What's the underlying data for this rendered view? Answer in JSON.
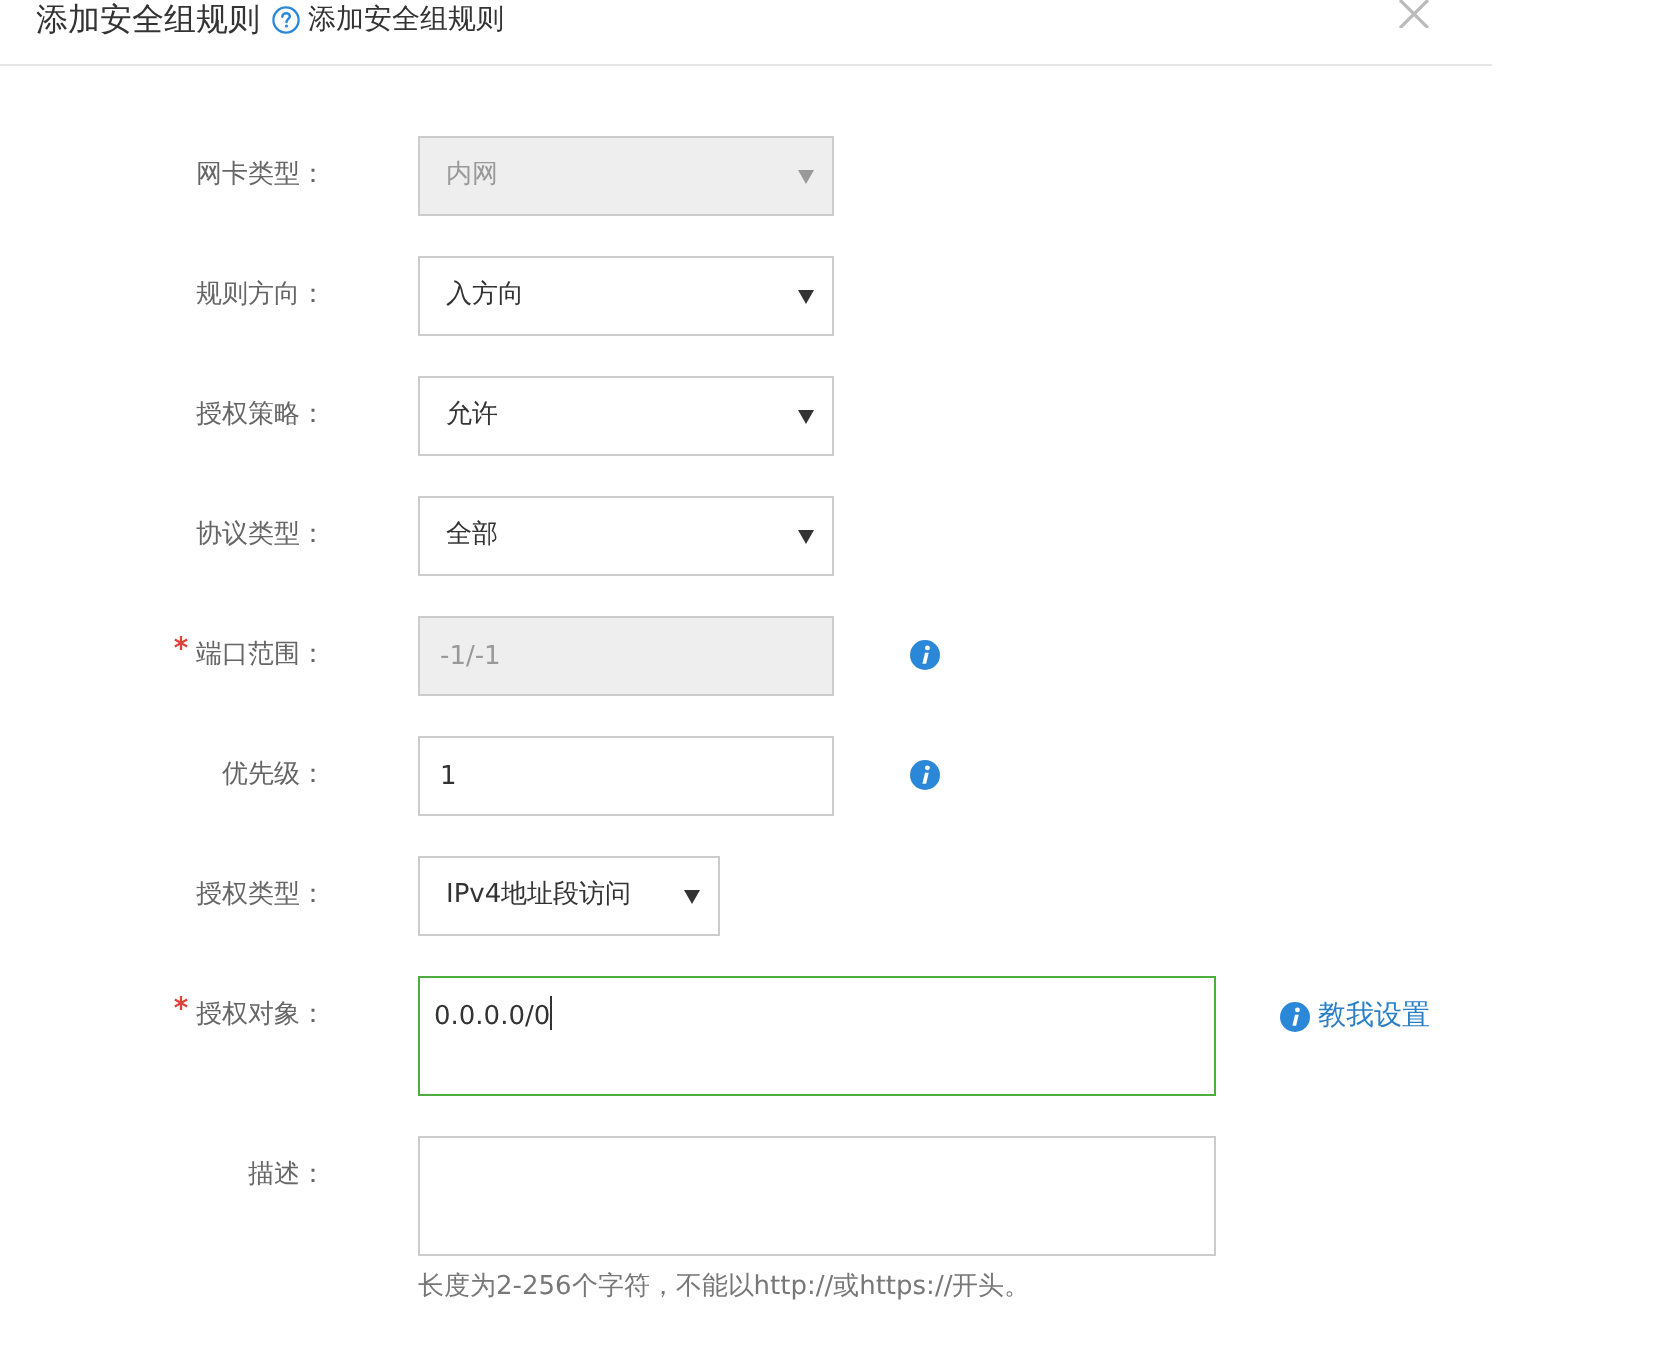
{
  "dialog": {
    "title": "添加安全组规则",
    "help_text": "添加安全组规则"
  },
  "fields": [
    {
      "kind": "select",
      "label": "网卡类型：",
      "required": false,
      "value": "内网",
      "disabled": true,
      "info": false
    },
    {
      "kind": "select",
      "label": "规则方向：",
      "required": false,
      "value": "入方向",
      "disabled": false,
      "info": false
    },
    {
      "kind": "select",
      "label": "授权策略：",
      "required": false,
      "value": "允许",
      "disabled": false,
      "info": false
    },
    {
      "kind": "select",
      "label": "协议类型：",
      "required": false,
      "value": "全部",
      "disabled": false,
      "info": false
    },
    {
      "kind": "input",
      "label": "端口范围：",
      "required": true,
      "value": "-1/-1",
      "disabled": true,
      "info": true
    },
    {
      "kind": "input",
      "label": "优先级：",
      "required": false,
      "value": "1",
      "disabled": false,
      "info": true
    },
    {
      "kind": "shortselect",
      "label": "授权类型：",
      "required": false,
      "value": "IPv4地址段访问",
      "disabled": false,
      "info": false
    },
    {
      "kind": "textarea",
      "label": "授权对象：",
      "required": true,
      "value": "0.0.0.0/0",
      "disabled": false,
      "focused": true,
      "info": false,
      "link": "教我设置"
    },
    {
      "kind": "textarea",
      "label": "描述：",
      "required": false,
      "disabled": false,
      "focused": false,
      "info": false,
      "hint": "长度为2-256个字符，不能以http://或https://开头。"
    }
  ]
}
